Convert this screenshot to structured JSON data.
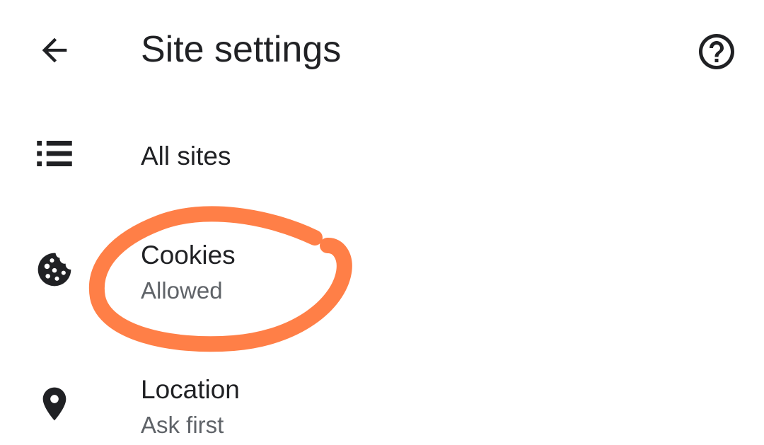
{
  "header": {
    "title": "Site settings",
    "back_icon": "arrow-back-icon",
    "help_icon": "help-circle-icon"
  },
  "items": [
    {
      "title": "All sites",
      "subtitle": "",
      "icon": "list-icon"
    },
    {
      "title": "Cookies",
      "subtitle": "Allowed",
      "icon": "cookie-icon"
    },
    {
      "title": "Location",
      "subtitle": "Ask first",
      "icon": "location-pin-icon"
    }
  ],
  "colors": {
    "text_primary": "#202124",
    "text_secondary": "#5f6368",
    "annotation": "#ff7f47",
    "background": "#ffffff"
  }
}
